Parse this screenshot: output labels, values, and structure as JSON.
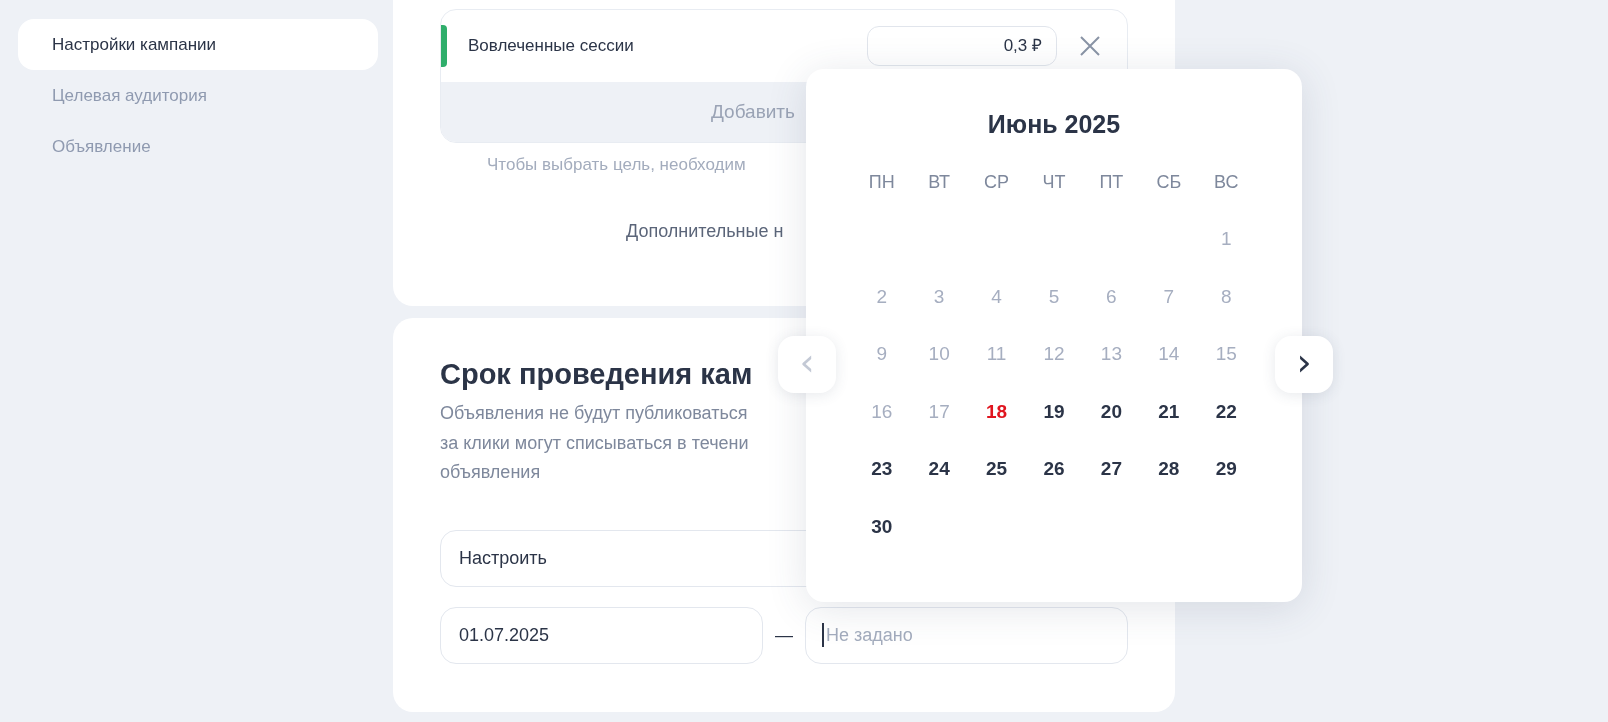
{
  "sidebar": {
    "items": [
      {
        "label": "Настройки кампании",
        "selected": true
      },
      {
        "label": "Целевая аудитория",
        "selected": false
      },
      {
        "label": "Объявление",
        "selected": false
      }
    ]
  },
  "goals_card": {
    "goal": {
      "name": "Вовлеченные сессии",
      "price": "0,3 ₽"
    },
    "add_goal": "Добавить",
    "hint": "Чтобы выбрать цель, необходим",
    "more_settings": "Дополнительные н"
  },
  "period_card": {
    "title": "Срок проведения кам",
    "description": [
      "Объявления не будут публиковаться",
      "за клики могут списываться в течени",
      "объявления"
    ],
    "mode_select": "Настроить",
    "start_date": "01.07.2025",
    "separator": "—",
    "end_date_placeholder": "Не задано"
  },
  "calendar": {
    "title": "Июнь 2025",
    "prev": {
      "label": "‹",
      "disabled": true
    },
    "next": {
      "label": "›",
      "disabled": false
    },
    "weekdays": [
      "ПН",
      "ВТ",
      "СР",
      "ЧТ",
      "ПТ",
      "СБ",
      "ВС"
    ],
    "weeks": [
      [
        {
          "day": "1",
          "kind": "past"
        }
      ],
      [
        {
          "day": "2",
          "kind": "past"
        },
        {
          "day": "3",
          "kind": "past"
        },
        {
          "day": "4",
          "kind": "past"
        },
        {
          "day": "5",
          "kind": "past"
        },
        {
          "day": "6",
          "kind": "past"
        },
        {
          "day": "7",
          "kind": "past"
        },
        {
          "day": "8",
          "kind": "past"
        }
      ],
      [
        {
          "day": "9",
          "kind": "past"
        },
        {
          "day": "10",
          "kind": "past"
        },
        {
          "day": "11",
          "kind": "past"
        },
        {
          "day": "12",
          "kind": "past"
        },
        {
          "day": "13",
          "kind": "past"
        },
        {
          "day": "14",
          "kind": "past"
        },
        {
          "day": "15",
          "kind": "past"
        }
      ],
      [
        {
          "day": "16",
          "kind": "past"
        },
        {
          "day": "17",
          "kind": "past"
        },
        {
          "day": "18",
          "kind": "today"
        },
        {
          "day": "19",
          "kind": "available"
        },
        {
          "day": "20",
          "kind": "available"
        },
        {
          "day": "21",
          "kind": "available"
        },
        {
          "day": "22",
          "kind": "available"
        }
      ],
      [
        {
          "day": "23",
          "kind": "available"
        },
        {
          "day": "24",
          "kind": "available"
        },
        {
          "day": "25",
          "kind": "available"
        },
        {
          "day": "26",
          "kind": "available"
        },
        {
          "day": "27",
          "kind": "available"
        },
        {
          "day": "28",
          "kind": "available"
        },
        {
          "day": "29",
          "kind": "available"
        }
      ],
      [
        {
          "day": "30",
          "kind": "available"
        }
      ]
    ]
  }
}
